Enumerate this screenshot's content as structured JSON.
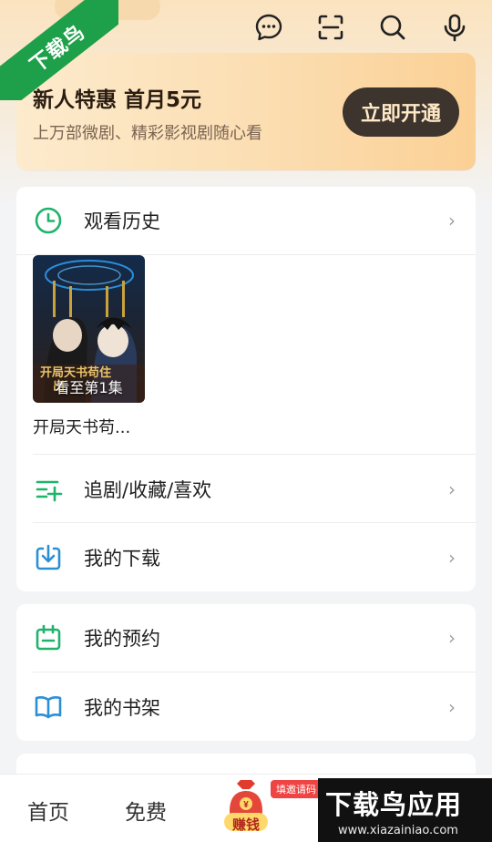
{
  "watermark": {
    "ribbon": "下载鸟",
    "brand_big": "下载鸟应用",
    "brand_url": "www.xiazainiao.com"
  },
  "header": {
    "icons": [
      "message-icon",
      "scan-icon",
      "search-icon",
      "mic-icon"
    ]
  },
  "promo": {
    "title": "新人特惠 首月5元",
    "subtitle": "上万部微剧、精彩影视剧随心看",
    "button": "立即开通"
  },
  "history": {
    "label": "观看历史",
    "item": {
      "caption": "看至第1集",
      "title": "开局天书苟..."
    }
  },
  "menu1": [
    {
      "label": "追剧/收藏/喜欢",
      "icon": "list-add-icon"
    },
    {
      "label": "我的下载",
      "icon": "download-icon"
    }
  ],
  "menu2": [
    {
      "label": "我的预约",
      "icon": "calendar-icon"
    },
    {
      "label": "我的书架",
      "icon": "book-icon"
    }
  ],
  "colors": {
    "accent": "#1fb36b",
    "download": "#2b8fd6"
  },
  "tabbar": {
    "home": "首页",
    "free": "免费",
    "earn": "赚钱",
    "invite_badge": "填邀请码"
  }
}
